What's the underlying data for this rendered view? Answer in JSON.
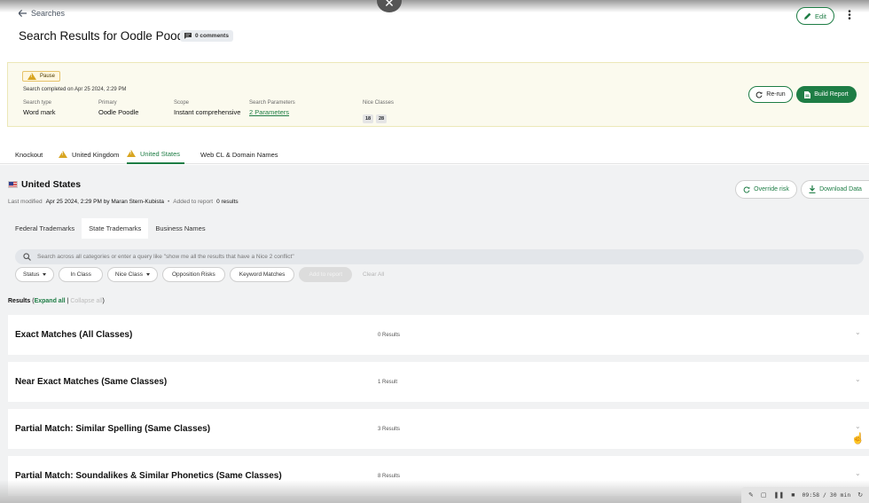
{
  "nav": {
    "back_label": "Searches"
  },
  "header": {
    "title": "Search Results for Oodle Poodle",
    "comments_label": "0 comments",
    "edit_label": "Edit"
  },
  "summary": {
    "status": "Pause",
    "completed_text": "Search completed on Apr 25 2024, 2:29 PM",
    "fields": {
      "search_type": {
        "label": "Search type",
        "value": "Word mark"
      },
      "primary": {
        "label": "Primary",
        "value": "Oodle Poodle"
      },
      "scope": {
        "label": "Scope",
        "value": "Instant comprehensive"
      },
      "params": {
        "label": "Search Parameters",
        "value": "2 Parameters"
      },
      "nice": {
        "label": "Nice Classes",
        "values": [
          "18",
          "28"
        ]
      }
    },
    "rerun_label": "Re-run",
    "build_label": "Build Report"
  },
  "tabs": [
    {
      "label": "Knockout"
    },
    {
      "label": "United Kingdom"
    },
    {
      "label": "United States"
    },
    {
      "label": "Web CL & Domain Names"
    }
  ],
  "country": {
    "name": "United States",
    "last_modified_label": "Last modified",
    "last_modified_value": "Apr 25 2024, 2:29 PM by Maran Stern-Kubista",
    "added_label": "Added to report",
    "added_value": "0 results",
    "override_label": "Override risk",
    "download_label": "Download Data"
  },
  "subtabs": [
    {
      "label": "Federal Trademarks"
    },
    {
      "label": "State Trademarks"
    },
    {
      "label": "Business Names"
    }
  ],
  "search": {
    "placeholder": "Search across all categories or enter a query like \"show me all the results that have a Nice 2 conflict\""
  },
  "filters": {
    "status": "Status",
    "in_class": "In Class",
    "nice_class": "Nice Class",
    "opposition": "Opposition Risks",
    "keyword": "Keyword Matches",
    "add_to_report": "Add to report",
    "clear_all": "Clear All"
  },
  "results": {
    "label": "Results",
    "expand_all": "Expand all",
    "collapse_all": "Collapse all",
    "sections": [
      {
        "title": "Exact Matches (All Classes)",
        "count": "0 Results"
      },
      {
        "title": "Near Exact Matches (Same Classes)",
        "count": "1 Result"
      },
      {
        "title": "Partial Match: Similar Spelling (Same Classes)",
        "count": "3 Results"
      },
      {
        "title": "Partial Match: Soundalikes & Similar Phonetics (Same Classes)",
        "count": "8 Results"
      }
    ]
  },
  "player": {
    "timer": "09:58 / 30 min"
  },
  "colors": {
    "accent": "#1e7d45",
    "warning": "#d8a521",
    "summary_bg": "#fbfaee"
  }
}
